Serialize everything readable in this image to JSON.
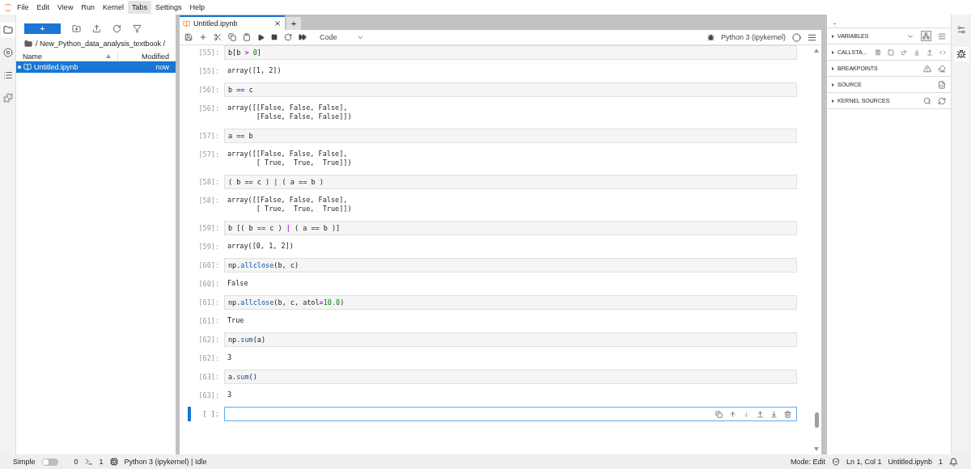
{
  "menu": [
    {
      "label": "File",
      "selected": false
    },
    {
      "label": "Edit",
      "selected": false
    },
    {
      "label": "View",
      "selected": false
    },
    {
      "label": "Run",
      "selected": false
    },
    {
      "label": "Kernel",
      "selected": false
    },
    {
      "label": "Tabs",
      "selected": true
    },
    {
      "label": "Settings",
      "selected": false
    },
    {
      "label": "Help",
      "selected": false
    }
  ],
  "left_sidebar": [
    {
      "kind": "files",
      "selected": true
    },
    {
      "kind": "running",
      "selected": false
    },
    {
      "kind": "toc",
      "selected": false
    },
    {
      "kind": "extensions",
      "selected": false
    }
  ],
  "file_browser": {
    "new_button": "+",
    "path": "/ New_Python_data_analysis_textbook /",
    "columns": [
      "Name",
      "Modified"
    ],
    "rows": [
      {
        "name": "Untitled.ipynb",
        "modified": "now",
        "selected": true,
        "running": true
      }
    ]
  },
  "notebook": {
    "tab_title": "Untitled.ipynb",
    "new_tab": "+",
    "cell_type": "Code",
    "kernel": "Python 3 (ipykernel)",
    "cells": [
      {
        "in_prompt": "[55]:",
        "active": false,
        "input": [
          {
            "text": "b[b ",
            "kind": "plain"
          },
          {
            "text": ">",
            "kind": "op"
          },
          {
            "text": " 0",
            "kind": "num"
          },
          {
            "text": "]",
            "kind": "plain"
          }
        ],
        "out_prompt": "[55]:",
        "output": [
          "array([1, 2])"
        ]
      },
      {
        "in_prompt": "[56]:",
        "active": false,
        "input": [
          {
            "text": "b ",
            "kind": "plain"
          },
          {
            "text": "==",
            "kind": "op"
          },
          {
            "text": " c",
            "kind": "plain"
          }
        ],
        "out_prompt": "[56]:",
        "output": [
          "array([[False, False, False],",
          "       [False, False, False]])"
        ]
      },
      {
        "in_prompt": "[57]:",
        "active": false,
        "input": [
          {
            "text": "a ",
            "kind": "plain"
          },
          {
            "text": "==",
            "kind": "op"
          },
          {
            "text": " b",
            "kind": "plain"
          }
        ],
        "out_prompt": "[57]:",
        "output": [
          "array([[False, False, False],",
          "       [ True,  True,  True]])"
        ]
      },
      {
        "in_prompt": "[58]:",
        "active": false,
        "input": [
          {
            "text": "( b ",
            "kind": "plain"
          },
          {
            "text": "==",
            "kind": "op"
          },
          {
            "text": " c ) ",
            "kind": "plain"
          },
          {
            "text": "|",
            "kind": "op"
          },
          {
            "text": " ( a ",
            "kind": "plain"
          },
          {
            "text": "==",
            "kind": "op"
          },
          {
            "text": " b )",
            "kind": "plain"
          }
        ],
        "out_prompt": "[58]:",
        "output": [
          "array([[False, False, False],",
          "       [ True,  True,  True]])"
        ]
      },
      {
        "in_prompt": "[59]:",
        "active": false,
        "input": [
          {
            "text": "b [( b ",
            "kind": "plain"
          },
          {
            "text": "==",
            "kind": "op"
          },
          {
            "text": " c ) ",
            "kind": "plain"
          },
          {
            "text": "|",
            "kind": "op"
          },
          {
            "text": " ( a ",
            "kind": "plain"
          },
          {
            "text": "==",
            "kind": "op"
          },
          {
            "text": " b )]",
            "kind": "plain"
          }
        ],
        "out_prompt": "[59]:",
        "output": [
          "array([0, 1, 2])"
        ]
      },
      {
        "in_prompt": "[60]:",
        "active": false,
        "input": [
          {
            "text": "np.",
            "kind": "plain"
          },
          {
            "text": "allclose",
            "kind": "fn"
          },
          {
            "text": "(b, c)",
            "kind": "plain"
          }
        ],
        "out_prompt": "[60]:",
        "output": [
          "False"
        ]
      },
      {
        "in_prompt": "[61]:",
        "active": false,
        "input": [
          {
            "text": "np.",
            "kind": "plain"
          },
          {
            "text": "allclose",
            "kind": "fn"
          },
          {
            "text": "(b, c, atol",
            "kind": "plain"
          },
          {
            "text": "=",
            "kind": "op"
          },
          {
            "text": "10.0",
            "kind": "num"
          },
          {
            "text": ")",
            "kind": "plain"
          }
        ],
        "out_prompt": "[61]:",
        "output": [
          "True"
        ]
      },
      {
        "in_prompt": "[62]:",
        "active": false,
        "input": [
          {
            "text": "np.",
            "kind": "plain"
          },
          {
            "text": "sum",
            "kind": "fn"
          },
          {
            "text": "(a)",
            "kind": "plain"
          }
        ],
        "out_prompt": "[62]:",
        "output": [
          "3"
        ]
      },
      {
        "in_prompt": "[63]:",
        "active": false,
        "input": [
          {
            "text": "a.",
            "kind": "plain"
          },
          {
            "text": "sum",
            "kind": "fn"
          },
          {
            "text": "()",
            "kind": "plain"
          }
        ],
        "out_prompt": "[63]:",
        "output": [
          "3"
        ]
      },
      {
        "in_prompt": "[ ]:",
        "active": true
      }
    ]
  },
  "debugger": {
    "title": "-",
    "sections": [
      {
        "label": "VARIABLES",
        "kind": "variables"
      },
      {
        "label": "CALLSTA...",
        "kind": "callstack"
      },
      {
        "label": "BREAKPOINTS",
        "kind": "breakpoints"
      },
      {
        "label": "SOURCE",
        "kind": "source"
      },
      {
        "label": "KERNEL SOURCES",
        "kind": "kernel_sources"
      }
    ]
  },
  "right_sidebar": [
    {
      "kind": "property_inspector",
      "selected": false
    },
    {
      "kind": "debugger",
      "selected": true
    }
  ],
  "status_bar": {
    "simple_label": "Simple",
    "simple_on": false,
    "terminals": "0",
    "kernels": "1",
    "kernel_status": "Python 3 (ipykernel) | Idle",
    "mode": "Mode: Edit",
    "position": "Ln 1, Col 1",
    "file": "Untitled.ipynb",
    "notifications": "1"
  }
}
